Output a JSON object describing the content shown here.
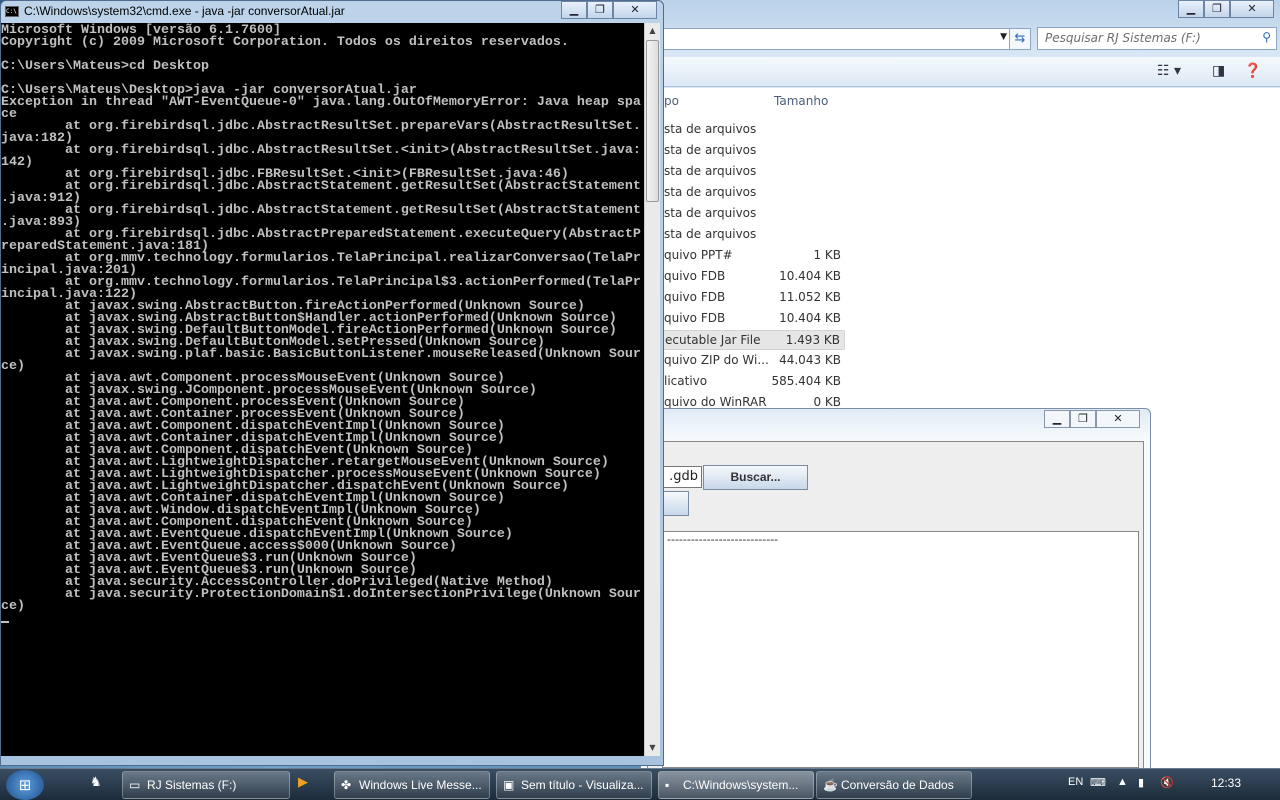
{
  "cmd": {
    "title": "C:\\Windows\\system32\\cmd.exe - java  -jar conversorAtual.jar",
    "lines": [
      "Microsoft Windows [versão 6.1.7600]",
      "Copyright (c) 2009 Microsoft Corporation. Todos os direitos reservados.",
      "",
      "C:\\Users\\Mateus>cd Desktop",
      "",
      "C:\\Users\\Mateus\\Desktop>java -jar conversorAtual.jar",
      "Exception in thread \"AWT-EventQueue-0\" java.lang.OutOfMemoryError: Java heap spa",
      "ce",
      "        at org.firebirdsql.jdbc.AbstractResultSet.prepareVars(AbstractResultSet.",
      "java:182)",
      "        at org.firebirdsql.jdbc.AbstractResultSet.<init>(AbstractResultSet.java:",
      "142)",
      "        at org.firebirdsql.jdbc.FBResultSet.<init>(FBResultSet.java:46)",
      "        at org.firebirdsql.jdbc.AbstractStatement.getResultSet(AbstractStatement",
      ".java:912)",
      "        at org.firebirdsql.jdbc.AbstractStatement.getResultSet(AbstractStatement",
      ".java:893)",
      "        at org.firebirdsql.jdbc.AbstractPreparedStatement.executeQuery(AbstractP",
      "reparedStatement.java:181)",
      "        at org.mmv.technology.formularios.TelaPrincipal.realizarConversao(TelaPr",
      "incipal.java:201)",
      "        at org.mmv.technology.formularios.TelaPrincipal$3.actionPerformed(TelaPr",
      "incipal.java:122)",
      "        at javax.swing.AbstractButton.fireActionPerformed(Unknown Source)",
      "        at javax.swing.AbstractButton$Handler.actionPerformed(Unknown Source)",
      "        at javax.swing.DefaultButtonModel.fireActionPerformed(Unknown Source)",
      "        at javax.swing.DefaultButtonModel.setPressed(Unknown Source)",
      "        at javax.swing.plaf.basic.BasicButtonListener.mouseReleased(Unknown Sour",
      "ce)",
      "        at java.awt.Component.processMouseEvent(Unknown Source)",
      "        at javax.swing.JComponent.processMouseEvent(Unknown Source)",
      "        at java.awt.Component.processEvent(Unknown Source)",
      "        at java.awt.Container.processEvent(Unknown Source)",
      "        at java.awt.Component.dispatchEventImpl(Unknown Source)",
      "        at java.awt.Container.dispatchEventImpl(Unknown Source)",
      "        at java.awt.Component.dispatchEvent(Unknown Source)",
      "        at java.awt.LightweightDispatcher.retargetMouseEvent(Unknown Source)",
      "        at java.awt.LightweightDispatcher.processMouseEvent(Unknown Source)",
      "        at java.awt.LightweightDispatcher.dispatchEvent(Unknown Source)",
      "        at java.awt.Container.dispatchEventImpl(Unknown Source)",
      "        at java.awt.Window.dispatchEventImpl(Unknown Source)",
      "        at java.awt.Component.dispatchEvent(Unknown Source)",
      "        at java.awt.EventQueue.dispatchEventImpl(Unknown Source)",
      "        at java.awt.EventQueue.access$000(Unknown Source)",
      "        at java.awt.EventQueue$3.run(Unknown Source)",
      "        at java.awt.EventQueue$3.run(Unknown Source)",
      "        at java.security.AccessController.doPrivileged(Native Method)",
      "        at java.security.ProtectionDomain$1.doIntersectionPrivilege(Unknown Sour",
      "ce)"
    ]
  },
  "explorer": {
    "search_placeholder": "Pesquisar RJ Sistemas (F:)",
    "columns": {
      "type": "po",
      "size": "Tamanho"
    },
    "rows": [
      {
        "type": "sta de arquivos",
        "size": ""
      },
      {
        "type": "sta de arquivos",
        "size": ""
      },
      {
        "type": "sta de arquivos",
        "size": ""
      },
      {
        "type": "sta de arquivos",
        "size": ""
      },
      {
        "type": "sta de arquivos",
        "size": ""
      },
      {
        "type": "sta de arquivos",
        "size": ""
      },
      {
        "type": "quivo PPT#",
        "size": "1 KB"
      },
      {
        "type": "quivo FDB",
        "size": "10.404 KB"
      },
      {
        "type": "quivo FDB",
        "size": "11.052 KB"
      },
      {
        "type": "quivo FDB",
        "size": "10.404 KB"
      },
      {
        "type": "ecutable Jar File",
        "size": "1.493 KB",
        "selected": true
      },
      {
        "type": "quivo ZIP do Wi...",
        "size": "44.043 KB"
      },
      {
        "type": "licativo",
        "size": "585.404 KB"
      },
      {
        "type": "quivo do WinRAR",
        "size": "0 KB"
      }
    ]
  },
  "java_app": {
    "file_field_value": ".gdb",
    "browse_label": "Buscar...",
    "output_text": "----------------------------"
  },
  "taskbar": {
    "items": [
      {
        "label": "RJ Sistemas (F:)",
        "icon": "drive-icon"
      },
      {
        "label": "Windows Live Messe...",
        "icon": "messenger-icon"
      },
      {
        "label": "Sem título - Visualiza...",
        "icon": "viewer-icon"
      },
      {
        "label": "C:\\Windows\\system...",
        "icon": "cmd-icon",
        "active": true
      },
      {
        "label": "Conversão de Dados",
        "icon": "java-icon"
      }
    ],
    "language": "EN",
    "clock": "12:33"
  }
}
